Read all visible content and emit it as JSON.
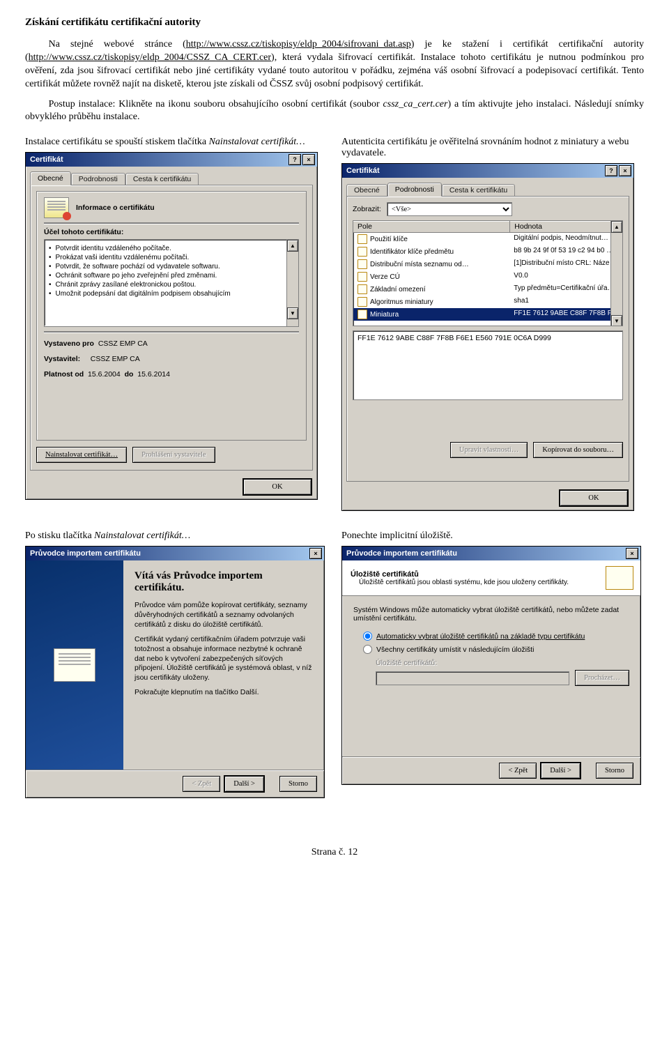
{
  "page": {
    "title": "Získání certifikátu certifikační autority",
    "para1_a": "Na stejné webové stránce (",
    "para1_link1": "http://www.cssz.cz/tiskopisy/eldp_2004/sifrovani_dat.asp",
    "para1_b": ") je ke stažení i certifikát certifikační autority (",
    "para1_link2": "http://www.cssz.cz/tiskopisy/eldp_2004/CSSZ_CA_CERT.cer",
    "para1_c": "), která vydala šifrovací certifikát. Instalace tohoto certifikátu je nutnou podmínkou pro ověření, zda jsou šifrovací certifikát nebo jiné certifikáty vydané touto autoritou v pořádku, zejména váš osobní šifrovací a podepisovací certifikát. Tento certifikát můžete rovněž najít na disketě, kterou jste získali od ČSSZ svůj osobní podpisový certifikát.",
    "para2_a": "Postup instalace: Klikněte na ikonu souboru obsahujícího osobní certifikát (soubor ",
    "para2_ital": "cssz_ca_cert.cer",
    "para2_b": ") a tím aktivujte jeho instalaci. Následují snímky obvyklého průběhu instalace.",
    "cap_left1_a": "Instalace certifikátu se spouští stiskem tlačítka ",
    "cap_left1_ital": "Nainstalovat certifikát…",
    "cap_right1": "Autenticita certifikátu je ověřitelná srovnáním hodnot z miniatury a webu vydavatele.",
    "cap_left2_a": "Po stisku tlačítka ",
    "cap_left2_ital": "Nainstalovat certifikát…",
    "cap_right2": "Ponechte implicitní úložiště.",
    "footer": "Strana č. 12"
  },
  "cert_general": {
    "window_title": "Certifikát",
    "tabs": {
      "general": "Obecné",
      "details": "Podrobnosti",
      "path": "Cesta k certifikátu"
    },
    "info_title": "Informace o certifikátu",
    "purpose_heading": "Účel tohoto certifikátu:",
    "purposes": [
      "Potvrdit identitu vzdáleného počítače.",
      "Prokázat vaši identitu vzdálenému počítači.",
      "Potvrdit, že software pochází od vydavatele softwaru.",
      "Ochránit software po jeho zveřejnění před změnami.",
      "Chránit zprávy zasílané elektronickou poštou.",
      "Umožnit podepsání dat digitálním podpisem obsahujícím"
    ],
    "issued_to_label": "Vystaveno pro",
    "issued_to": "CSSZ EMP CA",
    "issuer_label": "Vystavitel:",
    "issuer": "CSSZ EMP CA",
    "valid_label_a": "Platnost od",
    "valid_from": "15.6.2004",
    "valid_label_b": "do",
    "valid_to": "15.6.2014",
    "btn_install": "Nainstalovat certifikát…",
    "btn_statement": "Prohlášení vystavitele",
    "btn_ok": "OK"
  },
  "cert_details": {
    "window_title": "Certifikát",
    "show_label": "Zobrazit:",
    "show_value": "<Vše>",
    "col_field": "Pole",
    "col_value": "Hodnota",
    "rows": [
      {
        "field": "Použití klíče",
        "value": "Digitální podpis, Neodmítnut…"
      },
      {
        "field": "Identifikátor klíče předmětu",
        "value": "b8 9b 24 9f 0f 53 19 c2 94 b0 …"
      },
      {
        "field": "Distribuční místa seznamu od…",
        "value": "[1]Distribuční místo CRL: Náze…"
      },
      {
        "field": "Verze CÚ",
        "value": "V0.0"
      },
      {
        "field": "Základní omezení",
        "value": "Typ předmětu=Certifikační úřa…"
      },
      {
        "field": "Algoritmus miniatury",
        "value": "sha1"
      },
      {
        "field": "Miniatura",
        "value": "FF1E 7612 9ABE C88F 7F8B F…"
      }
    ],
    "selected_value": "FF1E 7612 9ABE C88F 7F8B F6E1 E560 791E 0C6A D999",
    "btn_edit": "Upravit vlastnosti…",
    "btn_copy": "Kopírovat do souboru…",
    "btn_ok": "OK"
  },
  "wizard_intro": {
    "window_title": "Průvodce importem certifikátu",
    "title": "Vítá vás Průvodce importem certifikátu.",
    "p1": "Průvodce vám pomůže kopírovat certifikáty, seznamy důvěryhodných certifikátů a seznamy odvolaných certifikátů z disku do úložiště certifikátů.",
    "p2": "Certifikát vydaný certifikačním úřadem potvrzuje vaši totožnost a obsahuje informace nezbytné k ochraně dat nebo k vytvoření zabezpečených síťových připojení. Úložiště certifikátů je systémová oblast, v níž jsou certifikáty uloženy.",
    "p3": "Pokračujte klepnutím na tlačítko Další.",
    "btn_back": "< Zpět",
    "btn_next": "Další >",
    "btn_cancel": "Storno"
  },
  "wizard_store": {
    "window_title": "Průvodce importem certifikátu",
    "header_title": "Úložiště certifikátů",
    "header_sub": "Úložiště certifikátů jsou oblasti systému, kde jsou uloženy certifikáty.",
    "body_text": "Systém Windows může automaticky vybrat úložiště certifikátů, nebo můžete zadat umístění certifikátu.",
    "opt_auto": "Automaticky vybrat úložiště certifikátů na základě typu certifikátu",
    "opt_manual": "Všechny certifikáty umístit v následujícím úložišti",
    "store_label": "Úložiště certifikátů:",
    "btn_browse": "Procházet…",
    "btn_back": "< Zpět",
    "btn_next": "Další >",
    "btn_cancel": "Storno"
  }
}
